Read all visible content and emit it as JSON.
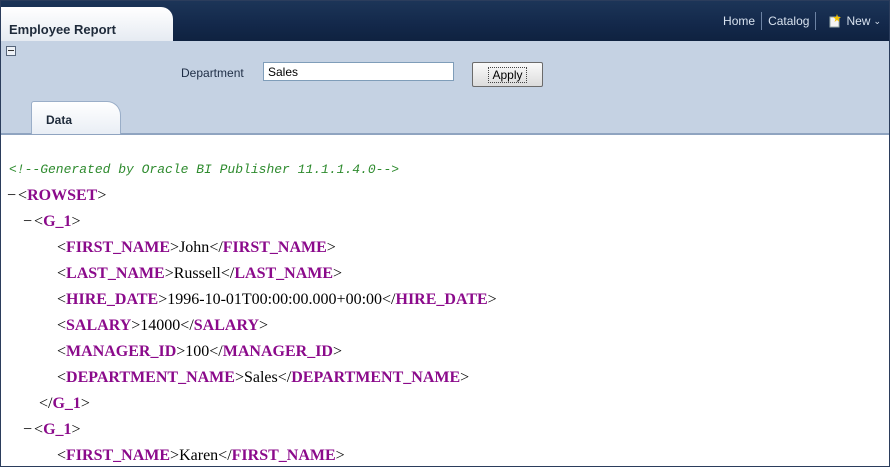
{
  "header": {
    "report_title": "Employee Report",
    "nav": {
      "home": "Home",
      "catalog": "Catalog",
      "new": "New"
    }
  },
  "params": {
    "department_label": "Department",
    "department_value": "Sales",
    "apply_label": "Apply"
  },
  "tabs": {
    "data_label": "Data"
  },
  "xml": {
    "comment": "<!--Generated by Oracle BI Publisher 11.1.1.4.0-->",
    "toggle": "−",
    "lt": "<",
    "gt": ">",
    "lt_close": "</",
    "rowset": "ROWSET",
    "group": "G_1",
    "fields": [
      {
        "tag": "FIRST_NAME",
        "value": "John"
      },
      {
        "tag": "LAST_NAME",
        "value": "Russell"
      },
      {
        "tag": "HIRE_DATE",
        "value": "1996-10-01T00:00:00.000+00:00"
      },
      {
        "tag": "SALARY",
        "value": "14000"
      },
      {
        "tag": "MANAGER_ID",
        "value": "100"
      },
      {
        "tag": "DEPARTMENT_NAME",
        "value": "Sales"
      }
    ],
    "second_first_name": {
      "tag": "FIRST_NAME",
      "value": "Karen"
    }
  },
  "colors": {
    "header_bg": "#13284a",
    "panel_bg": "#c5d2e3",
    "tag_color": "#8b0a8b",
    "comment_color": "#2e8b2e"
  }
}
